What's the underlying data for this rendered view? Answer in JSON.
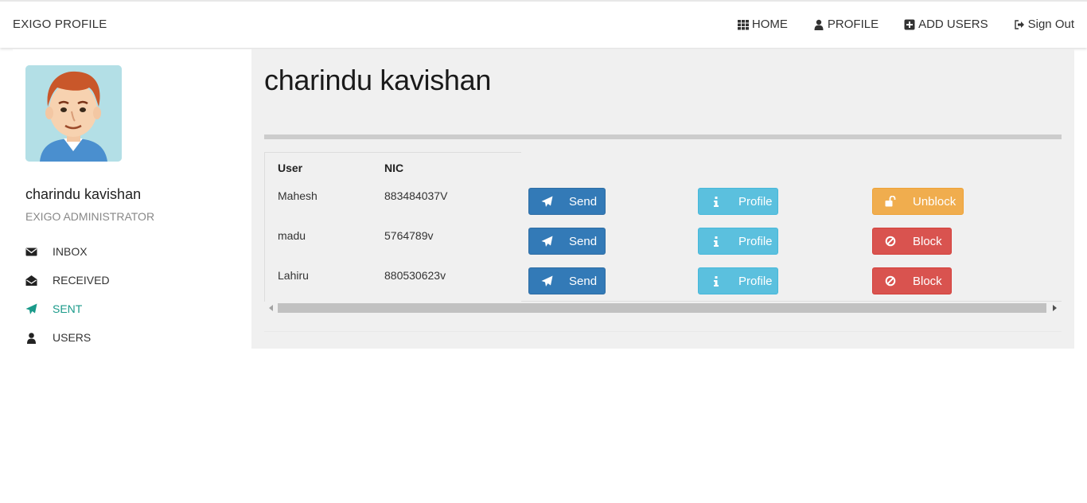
{
  "brand": "EXIGO PROFILE",
  "nav": {
    "home": "HOME",
    "profile": "PROFILE",
    "add_users": "ADD USERS",
    "sign_out": "Sign Out"
  },
  "sidebar": {
    "name": "charindu kavishan",
    "role": "EXIGO ADMINISTRATOR",
    "items": [
      {
        "label": "INBOX",
        "icon": "envelope-icon"
      },
      {
        "label": "RECEIVED",
        "icon": "envelope-open-icon"
      },
      {
        "label": "SENT",
        "icon": "paper-plane-icon",
        "active": true
      },
      {
        "label": "USERS",
        "icon": "user-icon"
      }
    ]
  },
  "main": {
    "title": "charindu kavishan",
    "table": {
      "headers": [
        "User",
        "NIC"
      ],
      "rows": [
        {
          "user": "Mahesh",
          "nic": "883484037V",
          "send": "Send",
          "profile": "Profile",
          "action": "Unblock"
        },
        {
          "user": "madu",
          "nic": "5764789v",
          "send": "Send",
          "profile": "Profile",
          "action": "Block"
        },
        {
          "user": "Lahiru",
          "nic": "880530623v",
          "send": "Send",
          "profile": "Profile",
          "action": "Block"
        }
      ]
    }
  },
  "colors": {
    "send": "#337ab7",
    "profile": "#5bc0de",
    "unblock": "#f0ad4e",
    "block": "#d9534f",
    "active_menu": "#1a9a8a"
  }
}
